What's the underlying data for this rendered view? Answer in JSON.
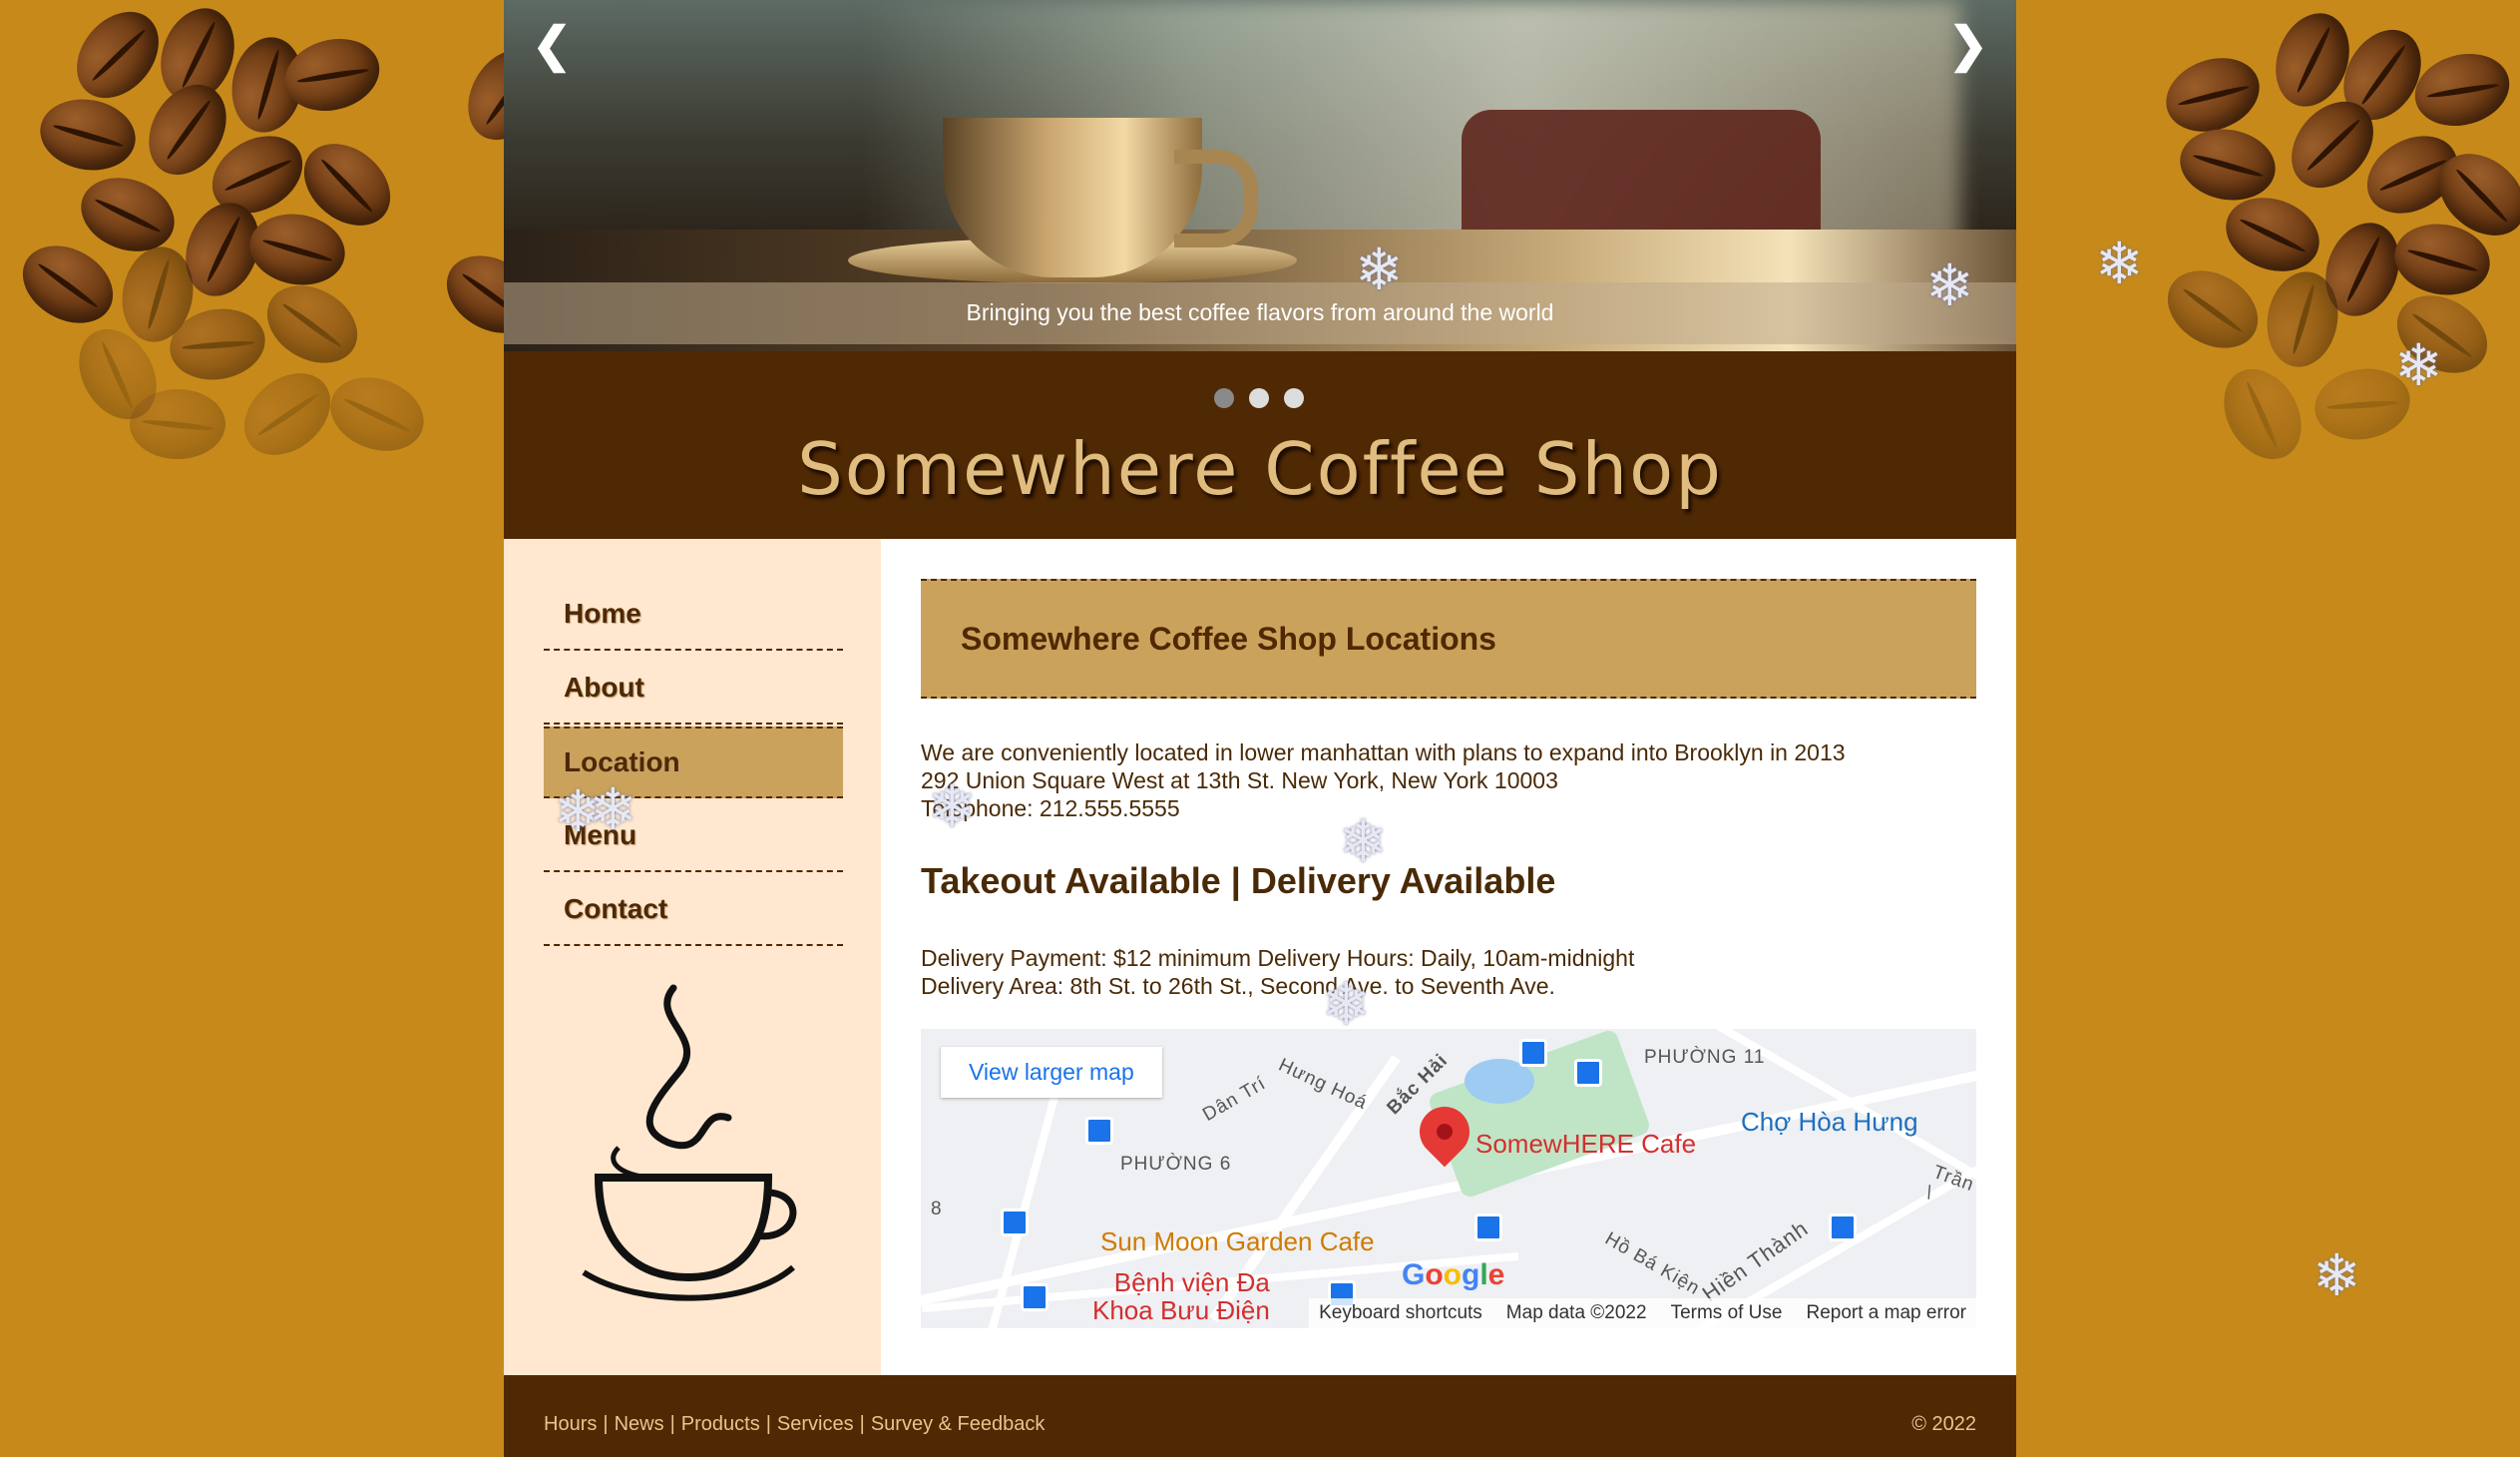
{
  "slider": {
    "caption": "Bringing you the best coffee flavors from around the world",
    "prev_arrow": "❮",
    "next_arrow": "❯",
    "dots_count": 3,
    "active_dot": 1
  },
  "header": {
    "title": "Somewhere Coffee Shop"
  },
  "nav": {
    "items": [
      {
        "label": "Home",
        "active": false
      },
      {
        "label": "About",
        "active": false
      },
      {
        "label": "Location",
        "active": true
      },
      {
        "label": "Menu",
        "active": false
      },
      {
        "label": "Contact",
        "active": false
      }
    ]
  },
  "content": {
    "heading": "Somewhere Coffee Shop Locations",
    "info_lines": [
      "We are conveniently located in lower manhattan with plans to expand into Brooklyn in 2013",
      "292 Union Square West at 13th St. New York, New York 10003",
      "Telephone: 212.555.5555"
    ],
    "takeout_heading": "Takeout Available | Delivery Available",
    "delivery_lines": [
      "Delivery Payment: $12 minimum Delivery Hours:  Daily, 10am-midnight",
      "Delivery Area: 8th St. to 26th St., Second Ave. to Seventh Ave."
    ]
  },
  "map": {
    "larger_map_label": "View larger map",
    "labels": {
      "phuong11": "PHƯỜNG 11",
      "phuong6": "PHƯỜNG 6",
      "bac_hai": "Bắc Hải",
      "hung_hoa": "Hưng Hoá",
      "dan_tri": "Dân Trí",
      "ho_ba_kien": "Hồ Bá Kiện",
      "hien_thanh": "Hiền Thành",
      "tran": "Trần \\",
      "eight": "8"
    },
    "pois": {
      "somewhere_cafe": "SomewHERE Cafe",
      "cho_hoa_hung": "Chợ Hòa Hưng",
      "sun_moon": "Sun Moon Garden Cafe",
      "hospital_line1": "Bệnh viện Đa",
      "hospital_line2": "Khoa Bưu Điện"
    },
    "google_logo": "Google",
    "footer": {
      "shortcuts": "Keyboard shortcuts",
      "map_data": "Map data ©2022",
      "terms": "Terms of Use",
      "report": "Report a map error"
    }
  },
  "footer": {
    "links": [
      "Hours",
      "News",
      "Products",
      "Services",
      "Survey & Feedback"
    ],
    "separator": "|",
    "copyright": "© 2022"
  },
  "decor": {
    "snowflake_glyph": "❄"
  },
  "colors": {
    "background": "#c78a1a",
    "brown_dark": "#4f2804",
    "tan_accent": "#cba25b",
    "sidebar_bg": "#ffe8cf",
    "title_gold": "#e0bd7e"
  }
}
